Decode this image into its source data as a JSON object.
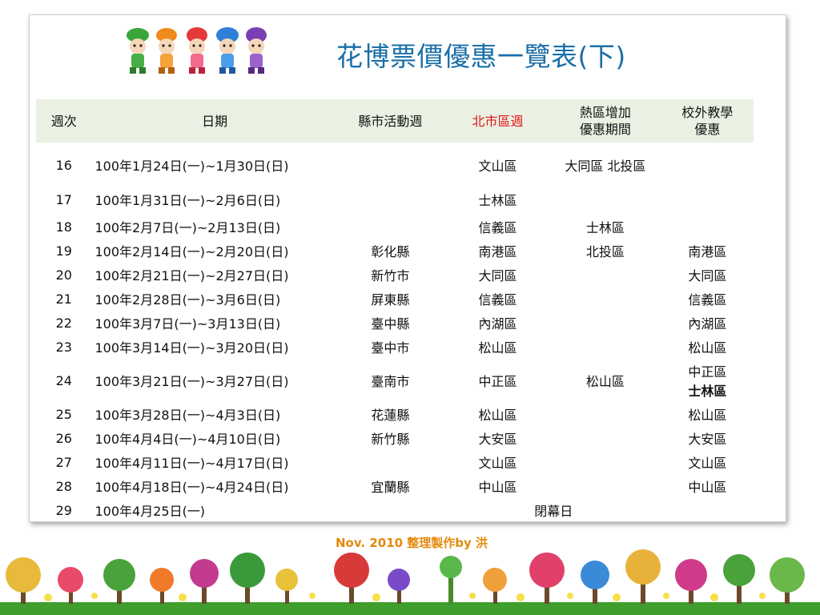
{
  "title": "花博票價優惠一覽表(下)",
  "footer": "Nov. 2010 整理製作by 洪",
  "table": {
    "headers": {
      "week": "週次",
      "date": "日期",
      "county": "縣市活動週",
      "taipei": "北市區週",
      "hot_line1": "熱區增加",
      "hot_line2": "優惠期間",
      "school_line1": "校外教學",
      "school_line2": "優惠"
    },
    "rows": [
      {
        "week": "16",
        "date": "100年1月24日(一)~1月30日(日)",
        "county": "",
        "taipei": "文山區",
        "hot": "大同區 北投區",
        "school": ""
      },
      {
        "week": "17",
        "date": "100年1月31日(一)~2月6日(日)",
        "county": "",
        "taipei": "士林區",
        "hot": "",
        "school": ""
      },
      {
        "week": "18",
        "date": "100年2月7日(一)~2月13日(日)",
        "county": "",
        "taipei": "信義區",
        "hot": "士林區",
        "school": ""
      },
      {
        "week": "19",
        "date": "100年2月14日(一)~2月20日(日)",
        "county": "彰化縣",
        "taipei": "南港區",
        "hot": "北投區",
        "school": "南港區"
      },
      {
        "week": "20",
        "date": "100年2月21日(一)~2月27日(日)",
        "county": "新竹市",
        "taipei": "大同區",
        "hot": "",
        "school": "大同區"
      },
      {
        "week": "21",
        "date": "100年2月28日(一)~3月6日(日)",
        "county": "屏東縣",
        "taipei": "信義區",
        "hot": "",
        "school": "信義區"
      },
      {
        "week": "22",
        "date": "100年3月7日(一)~3月13日(日)",
        "county": "臺中縣",
        "taipei": "內湖區",
        "hot": "",
        "school": "內湖區"
      },
      {
        "week": "23",
        "date": "100年3月14日(一)~3月20日(日)",
        "county": "臺中市",
        "taipei": "松山區",
        "hot": "",
        "school": "松山區"
      },
      {
        "week": "24",
        "date": "100年3月21日(一)~3月27日(日)",
        "county": "臺南市",
        "taipei": "中正區",
        "hot": "松山區",
        "school": "中正區",
        "school2": "士林區"
      },
      {
        "week": "25",
        "date": "100年3月28日(一)~4月3日(日)",
        "county": "花蓮縣",
        "taipei": "松山區",
        "hot": "",
        "school": "松山區"
      },
      {
        "week": "26",
        "date": "100年4月4日(一)~4月10日(日)",
        "county": "新竹縣",
        "taipei": "大安區",
        "hot": "",
        "school": "大安區"
      },
      {
        "week": "27",
        "date": "100年4月11日(一)~4月17日(日)",
        "county": "",
        "taipei": "文山區",
        "hot": "",
        "school": "文山區"
      },
      {
        "week": "28",
        "date": "100年4月18日(一)~4月24日(日)",
        "county": "宜蘭縣",
        "taipei": "中山區",
        "hot": "",
        "school": "中山區"
      },
      {
        "week": "29",
        "date": "100年4月25日(一)",
        "closing": "閉幕日"
      }
    ]
  },
  "colors": {
    "title": "#1a6fa8",
    "header_bg": "#eaf1e3",
    "taipei_header": "#e2131a",
    "footer": "#e38a0c"
  },
  "decorations": [
    "expo-mascots-illustration",
    "flower-garden-illustration"
  ]
}
